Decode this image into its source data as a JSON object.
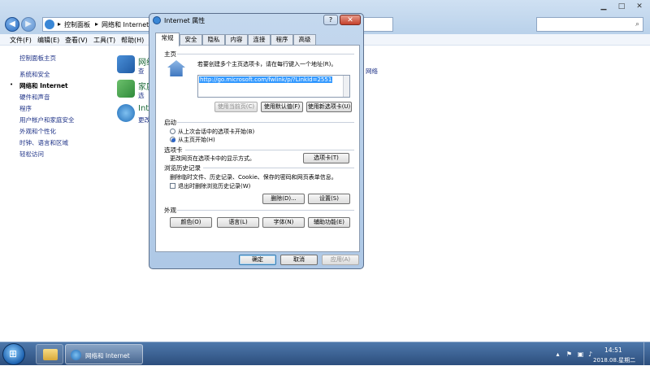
{
  "explorer": {
    "breadcrumb": [
      "控制面板",
      "网络和 Internet"
    ],
    "menu": [
      "文件(F)",
      "编辑(E)",
      "查看(V)",
      "工具(T)",
      "帮助(H)"
    ],
    "sidebar": [
      "控制面板主页",
      "系统和安全",
      "网络和 Internet",
      "硬件和声音",
      "程序",
      "用户帐户和家庭安全",
      "外观和个性化",
      "时钟、语言和区域",
      "轻松访问"
    ],
    "categories": [
      {
        "title": "网络",
        "sub": "查"
      },
      {
        "title": "家庭",
        "sub": "选"
      },
      {
        "title": "Inte",
        "sub": "更改"
      }
    ],
    "right_link": "网络"
  },
  "dialog": {
    "title": "Internet 属性",
    "help": "?",
    "close": "✕",
    "tabs": [
      "常规",
      "安全",
      "隐私",
      "内容",
      "连接",
      "程序",
      "高级"
    ],
    "homepage": {
      "heading": "主页",
      "desc": "若要创建多个主页选项卡，请在每行键入一个地址(R)。",
      "url": "http://go.microsoft.com/fwlink/p/?LinkId=2551",
      "btn_current": "使用当前页(C)",
      "btn_default": "使用默认值(F)",
      "btn_new_tab": "使用新选项卡(U)"
    },
    "startup": {
      "heading": "启动",
      "opt1": "从上次会话中的选项卡开始(B)",
      "opt2": "从主页开始(H)"
    },
    "tabs_group": {
      "heading": "选项卡",
      "desc": "更改网页在选项卡中的显示方式。",
      "btn": "选项卡(T)"
    },
    "history": {
      "heading": "浏览历史记录",
      "desc": "删除临时文件、历史记录、Cookie、保存的密码和网页表单信息。",
      "checkbox": "退出时删除浏览历史记录(W)",
      "btn_delete": "删除(D)...",
      "btn_settings": "设置(S)"
    },
    "appearance": {
      "heading": "外观",
      "btn_colors": "颜色(O)",
      "btn_languages": "语言(L)",
      "btn_fonts": "字体(N)",
      "btn_access": "辅助功能(E)"
    },
    "footer": {
      "ok": "确定",
      "cancel": "取消",
      "apply": "应用(A)"
    }
  },
  "taskbar": {
    "active_window": "网络和 Internet",
    "time": "14:51",
    "date": "2018.08.星期二"
  }
}
